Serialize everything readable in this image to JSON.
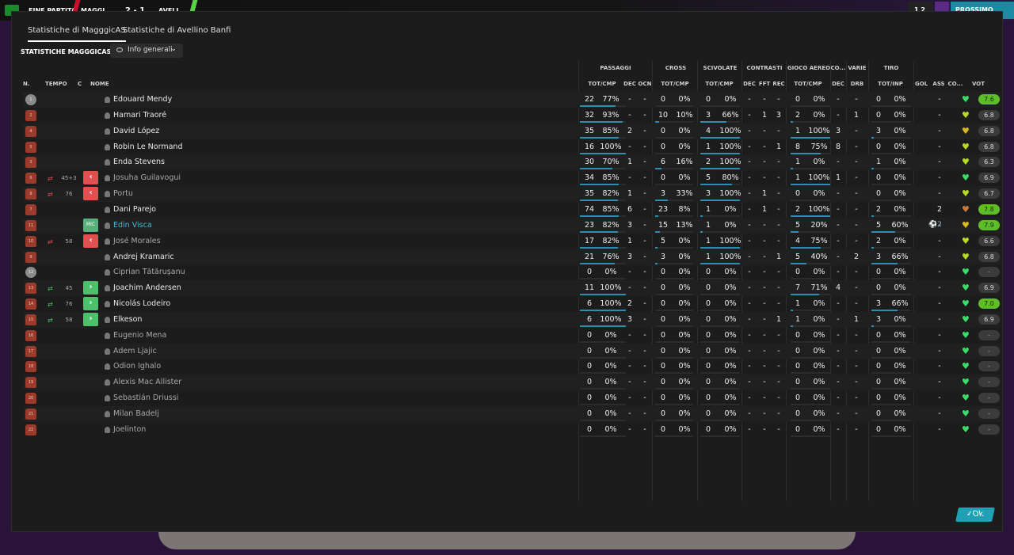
{
  "topbar": {
    "left_label": "FINE PARTITA",
    "home": "MAGGI...",
    "score": "2 - 1",
    "away": "AVELL...",
    "right_badge": "1 2",
    "right_button": "PROSSIMO"
  },
  "tabs": [
    {
      "label": "Statistiche di MagggicAS",
      "active": true
    },
    {
      "label": "Statistiche di Avellino Banfi",
      "active": false
    }
  ],
  "section_title": "STATISTICHE MAGGGICAS",
  "view_dropdown": {
    "selected": "Info generali",
    "icon": "eye-icon"
  },
  "column_groups": [
    "PASSAGGI",
    "CROSS",
    "SCIVOLATE",
    "CONTRASTI",
    "GIOCO AEREO",
    "CO...",
    "VARIE",
    "TIRO"
  ],
  "columns": {
    "num": "N.",
    "tempo": "TEMPO",
    "c": "C",
    "nome": "NOME",
    "pass_totcmp": "TOT/CMP",
    "pass_dec": "DEC",
    "pass_ocn": "OCN",
    "cross_totcmp": "TOT/CMP",
    "sciv_totcmp": "TOT/CMP",
    "contr_dec": "DEC",
    "contr_fft": "FFT",
    "contr_rec": "REC",
    "aereo_totcmp": "TOT/CMP",
    "co_dec": "DEC",
    "varie_drb": "DRB",
    "tiro_totinp": "TOT/INP",
    "gol": "GOL",
    "ass": "ASS",
    "co": "CO...",
    "voto": "VOT"
  },
  "players": [
    {
      "num": "1",
      "gk": true,
      "sub_icon": "",
      "time": "",
      "badge": "",
      "name": "Edouard Mendy",
      "style": "normal",
      "pass_tot": "22",
      "pass_pct": "77%",
      "pass_dec": "-",
      "pass_ocn": "-",
      "cross_tot": "0",
      "cross_pct": "0%",
      "sciv_tot": "0",
      "sciv_pct": "0%",
      "c_dec": "-",
      "c_fft": "-",
      "c_rec": "-",
      "aer_tot": "0",
      "aer_pct": "0%",
      "co_dec": "-",
      "drb": "-",
      "tiro_tot": "0",
      "tiro_pct": "0%",
      "gol": "",
      "ass": "-",
      "heart": "#3ddc6a",
      "voto": "7.6",
      "good": true
    },
    {
      "num": "2",
      "gk": false,
      "sub_icon": "",
      "time": "",
      "badge": "",
      "name": "Hamari Traoré",
      "style": "normal",
      "pass_tot": "32",
      "pass_pct": "93%",
      "pass_dec": "-",
      "pass_ocn": "-",
      "cross_tot": "10",
      "cross_pct": "10%",
      "sciv_tot": "3",
      "sciv_pct": "66%",
      "c_dec": "-",
      "c_fft": "1",
      "c_rec": "3",
      "aer_tot": "2",
      "aer_pct": "0%",
      "co_dec": "-",
      "drb": "1",
      "tiro_tot": "0",
      "tiro_pct": "0%",
      "gol": "",
      "ass": "-",
      "heart": "#b8d82a",
      "voto": "6.8",
      "good": false
    },
    {
      "num": "4",
      "gk": false,
      "sub_icon": "",
      "time": "",
      "badge": "",
      "name": "David López",
      "style": "normal",
      "pass_tot": "35",
      "pass_pct": "85%",
      "pass_dec": "2",
      "pass_ocn": "-",
      "cross_tot": "0",
      "cross_pct": "0%",
      "sciv_tot": "4",
      "sciv_pct": "100%",
      "c_dec": "-",
      "c_fft": "-",
      "c_rec": "-",
      "aer_tot": "1",
      "aer_pct": "100%",
      "co_dec": "3",
      "drb": "-",
      "tiro_tot": "3",
      "tiro_pct": "0%",
      "gol": "",
      "ass": "-",
      "heart": "#d8b82a",
      "voto": "6.8",
      "good": false
    },
    {
      "num": "5",
      "gk": false,
      "sub_icon": "",
      "time": "",
      "badge": "",
      "name": "Robin Le Normand",
      "style": "normal",
      "pass_tot": "16",
      "pass_pct": "100%",
      "pass_dec": "-",
      "pass_ocn": "-",
      "cross_tot": "0",
      "cross_pct": "0%",
      "sciv_tot": "1",
      "sciv_pct": "100%",
      "c_dec": "-",
      "c_fft": "-",
      "c_rec": "1",
      "aer_tot": "8",
      "aer_pct": "75%",
      "co_dec": "8",
      "drb": "-",
      "tiro_tot": "0",
      "tiro_pct": "0%",
      "gol": "",
      "ass": "-",
      "heart": "#b8d82a",
      "voto": "6.8",
      "good": false
    },
    {
      "num": "3",
      "gk": false,
      "sub_icon": "",
      "time": "",
      "badge": "",
      "name": "Enda Stevens",
      "style": "normal",
      "pass_tot": "30",
      "pass_pct": "70%",
      "pass_dec": "1",
      "pass_ocn": "-",
      "cross_tot": "6",
      "cross_pct": "16%",
      "sciv_tot": "2",
      "sciv_pct": "100%",
      "c_dec": "-",
      "c_fft": "-",
      "c_rec": "-",
      "aer_tot": "1",
      "aer_pct": "0%",
      "co_dec": "-",
      "drb": "-",
      "tiro_tot": "1",
      "tiro_pct": "0%",
      "gol": "",
      "ass": "-",
      "heart": "#b8d82a",
      "voto": "6.3",
      "good": false
    },
    {
      "num": "6",
      "gk": false,
      "sub_icon": "out",
      "time": "45+3",
      "badge": "out",
      "name": "Josuha Guilavogui",
      "style": "dim",
      "pass_tot": "34",
      "pass_pct": "85%",
      "pass_dec": "-",
      "pass_ocn": "-",
      "cross_tot": "0",
      "cross_pct": "0%",
      "sciv_tot": "5",
      "sciv_pct": "80%",
      "c_dec": "-",
      "c_fft": "-",
      "c_rec": "-",
      "aer_tot": "1",
      "aer_pct": "100%",
      "co_dec": "1",
      "drb": "-",
      "tiro_tot": "0",
      "tiro_pct": "0%",
      "gol": "",
      "ass": "-",
      "heart": "#3ddc6a",
      "voto": "6.9",
      "good": false
    },
    {
      "num": "8",
      "gk": false,
      "sub_icon": "out",
      "time": "76",
      "badge": "out",
      "name": "Portu",
      "style": "dim",
      "pass_tot": "35",
      "pass_pct": "82%",
      "pass_dec": "1",
      "pass_ocn": "-",
      "cross_tot": "3",
      "cross_pct": "33%",
      "sciv_tot": "3",
      "sciv_pct": "100%",
      "c_dec": "-",
      "c_fft": "1",
      "c_rec": "-",
      "aer_tot": "0",
      "aer_pct": "0%",
      "co_dec": "-",
      "drb": "-",
      "tiro_tot": "0",
      "tiro_pct": "0%",
      "gol": "",
      "ass": "-",
      "heart": "#b8d82a",
      "voto": "6.7",
      "good": false
    },
    {
      "num": "7",
      "gk": false,
      "sub_icon": "",
      "time": "",
      "badge": "",
      "name": "Dani Parejo",
      "style": "normal",
      "pass_tot": "74",
      "pass_pct": "85%",
      "pass_dec": "6",
      "pass_ocn": "-",
      "cross_tot": "23",
      "cross_pct": "8%",
      "sciv_tot": "1",
      "sciv_pct": "0%",
      "c_dec": "-",
      "c_fft": "1",
      "c_rec": "-",
      "aer_tot": "2",
      "aer_pct": "100%",
      "co_dec": "-",
      "drb": "-",
      "tiro_tot": "2",
      "tiro_pct": "0%",
      "gol": "",
      "ass": "2",
      "heart": "#c87a3a",
      "voto": "7.8",
      "good": true
    },
    {
      "num": "11",
      "gk": false,
      "sub_icon": "",
      "time": "",
      "badge": "pos",
      "name": "Edin Visca",
      "style": "link",
      "pass_tot": "23",
      "pass_pct": "82%",
      "pass_dec": "3",
      "pass_ocn": "-",
      "cross_tot": "15",
      "cross_pct": "13%",
      "sciv_tot": "1",
      "sciv_pct": "0%",
      "c_dec": "-",
      "c_fft": "-",
      "c_rec": "-",
      "aer_tot": "5",
      "aer_pct": "20%",
      "co_dec": "-",
      "drb": "-",
      "tiro_tot": "5",
      "tiro_pct": "60%",
      "gol": "2",
      "ass": "-",
      "heart": "#d8b82a",
      "voto": "7.9",
      "good": true
    },
    {
      "num": "10",
      "gk": false,
      "sub_icon": "out",
      "time": "58",
      "badge": "out",
      "name": "José Morales",
      "style": "dim",
      "pass_tot": "17",
      "pass_pct": "82%",
      "pass_dec": "1",
      "pass_ocn": "-",
      "cross_tot": "5",
      "cross_pct": "0%",
      "sciv_tot": "1",
      "sciv_pct": "100%",
      "c_dec": "-",
      "c_fft": "-",
      "c_rec": "-",
      "aer_tot": "4",
      "aer_pct": "75%",
      "co_dec": "-",
      "drb": "-",
      "tiro_tot": "2",
      "tiro_pct": "0%",
      "gol": "",
      "ass": "-",
      "heart": "#b8d82a",
      "voto": "6.6",
      "good": false
    },
    {
      "num": "9",
      "gk": false,
      "sub_icon": "",
      "time": "",
      "badge": "",
      "name": "Andrej Kramaric",
      "style": "normal",
      "pass_tot": "21",
      "pass_pct": "76%",
      "pass_dec": "3",
      "pass_ocn": "-",
      "cross_tot": "3",
      "cross_pct": "0%",
      "sciv_tot": "1",
      "sciv_pct": "100%",
      "c_dec": "-",
      "c_fft": "-",
      "c_rec": "1",
      "aer_tot": "5",
      "aer_pct": "40%",
      "co_dec": "-",
      "drb": "2",
      "tiro_tot": "3",
      "tiro_pct": "66%",
      "gol": "",
      "ass": "-",
      "heart": "#b8d82a",
      "voto": "6.8",
      "good": false
    },
    {
      "num": "12",
      "gk": true,
      "sub_icon": "",
      "time": "",
      "badge": "",
      "name": "Ciprian Tătărușanu",
      "style": "dim",
      "pass_tot": "0",
      "pass_pct": "0%",
      "pass_dec": "-",
      "pass_ocn": "-",
      "cross_tot": "0",
      "cross_pct": "0%",
      "sciv_tot": "0",
      "sciv_pct": "0%",
      "c_dec": "-",
      "c_fft": "-",
      "c_rec": "-",
      "aer_tot": "0",
      "aer_pct": "0%",
      "co_dec": "-",
      "drb": "-",
      "tiro_tot": "0",
      "tiro_pct": "0%",
      "gol": "",
      "ass": "-",
      "heart": "#3ddc6a",
      "voto": "-",
      "good": false
    },
    {
      "num": "13",
      "gk": false,
      "sub_icon": "in",
      "time": "45",
      "badge": "in",
      "name": "Joachim Andersen",
      "style": "normal",
      "pass_tot": "11",
      "pass_pct": "100%",
      "pass_dec": "-",
      "pass_ocn": "-",
      "cross_tot": "0",
      "cross_pct": "0%",
      "sciv_tot": "0",
      "sciv_pct": "0%",
      "c_dec": "-",
      "c_fft": "-",
      "c_rec": "-",
      "aer_tot": "7",
      "aer_pct": "71%",
      "co_dec": "4",
      "drb": "-",
      "tiro_tot": "0",
      "tiro_pct": "0%",
      "gol": "",
      "ass": "-",
      "heart": "#3ddc6a",
      "voto": "6.9",
      "good": false
    },
    {
      "num": "14",
      "gk": false,
      "sub_icon": "in",
      "time": "76",
      "badge": "in",
      "name": "Nicolás Lodeiro",
      "style": "normal",
      "pass_tot": "6",
      "pass_pct": "100%",
      "pass_dec": "2",
      "pass_ocn": "-",
      "cross_tot": "0",
      "cross_pct": "0%",
      "sciv_tot": "0",
      "sciv_pct": "0%",
      "c_dec": "-",
      "c_fft": "-",
      "c_rec": "-",
      "aer_tot": "1",
      "aer_pct": "0%",
      "co_dec": "-",
      "drb": "-",
      "tiro_tot": "3",
      "tiro_pct": "66%",
      "gol": "",
      "ass": "-",
      "heart": "#3ddc6a",
      "voto": "7.0",
      "good": true
    },
    {
      "num": "15",
      "gk": false,
      "sub_icon": "in",
      "time": "58",
      "badge": "in",
      "name": "Elkeson",
      "style": "normal",
      "pass_tot": "6",
      "pass_pct": "100%",
      "pass_dec": "3",
      "pass_ocn": "-",
      "cross_tot": "0",
      "cross_pct": "0%",
      "sciv_tot": "0",
      "sciv_pct": "0%",
      "c_dec": "-",
      "c_fft": "-",
      "c_rec": "1",
      "aer_tot": "1",
      "aer_pct": "0%",
      "co_dec": "-",
      "drb": "1",
      "tiro_tot": "3",
      "tiro_pct": "0%",
      "gol": "",
      "ass": "-",
      "heart": "#3ddc6a",
      "voto": "6.9",
      "good": false
    },
    {
      "num": "16",
      "gk": false,
      "sub_icon": "",
      "time": "",
      "badge": "",
      "name": "Eugenio Mena",
      "style": "dim",
      "pass_tot": "0",
      "pass_pct": "0%",
      "pass_dec": "-",
      "pass_ocn": "-",
      "cross_tot": "0",
      "cross_pct": "0%",
      "sciv_tot": "0",
      "sciv_pct": "0%",
      "c_dec": "-",
      "c_fft": "-",
      "c_rec": "-",
      "aer_tot": "0",
      "aer_pct": "0%",
      "co_dec": "-",
      "drb": "-",
      "tiro_tot": "0",
      "tiro_pct": "0%",
      "gol": "",
      "ass": "-",
      "heart": "#3ddc6a",
      "voto": "-",
      "good": false
    },
    {
      "num": "17",
      "gk": false,
      "sub_icon": "",
      "time": "",
      "badge": "",
      "name": "Adem Ljajic",
      "style": "dim",
      "pass_tot": "0",
      "pass_pct": "0%",
      "pass_dec": "-",
      "pass_ocn": "-",
      "cross_tot": "0",
      "cross_pct": "0%",
      "sciv_tot": "0",
      "sciv_pct": "0%",
      "c_dec": "-",
      "c_fft": "-",
      "c_rec": "-",
      "aer_tot": "0",
      "aer_pct": "0%",
      "co_dec": "-",
      "drb": "-",
      "tiro_tot": "0",
      "tiro_pct": "0%",
      "gol": "",
      "ass": "-",
      "heart": "#3ddc6a",
      "voto": "-",
      "good": false
    },
    {
      "num": "18",
      "gk": false,
      "sub_icon": "",
      "time": "",
      "badge": "",
      "name": "Odion Ighalo",
      "style": "dim",
      "pass_tot": "0",
      "pass_pct": "0%",
      "pass_dec": "-",
      "pass_ocn": "-",
      "cross_tot": "0",
      "cross_pct": "0%",
      "sciv_tot": "0",
      "sciv_pct": "0%",
      "c_dec": "-",
      "c_fft": "-",
      "c_rec": "-",
      "aer_tot": "0",
      "aer_pct": "0%",
      "co_dec": "-",
      "drb": "-",
      "tiro_tot": "0",
      "tiro_pct": "0%",
      "gol": "",
      "ass": "-",
      "heart": "#3ddc6a",
      "voto": "-",
      "good": false
    },
    {
      "num": "19",
      "gk": false,
      "sub_icon": "",
      "time": "",
      "badge": "",
      "name": "Alexis Mac Allister",
      "style": "dim",
      "pass_tot": "0",
      "pass_pct": "0%",
      "pass_dec": "-",
      "pass_ocn": "-",
      "cross_tot": "0",
      "cross_pct": "0%",
      "sciv_tot": "0",
      "sciv_pct": "0%",
      "c_dec": "-",
      "c_fft": "-",
      "c_rec": "-",
      "aer_tot": "0",
      "aer_pct": "0%",
      "co_dec": "-",
      "drb": "-",
      "tiro_tot": "0",
      "tiro_pct": "0%",
      "gol": "",
      "ass": "-",
      "heart": "#3ddc6a",
      "voto": "-",
      "good": false
    },
    {
      "num": "20",
      "gk": false,
      "sub_icon": "",
      "time": "",
      "badge": "",
      "name": "Sebastián Driussi",
      "style": "dim",
      "pass_tot": "0",
      "pass_pct": "0%",
      "pass_dec": "-",
      "pass_ocn": "-",
      "cross_tot": "0",
      "cross_pct": "0%",
      "sciv_tot": "0",
      "sciv_pct": "0%",
      "c_dec": "-",
      "c_fft": "-",
      "c_rec": "-",
      "aer_tot": "0",
      "aer_pct": "0%",
      "co_dec": "-",
      "drb": "-",
      "tiro_tot": "0",
      "tiro_pct": "0%",
      "gol": "",
      "ass": "-",
      "heart": "#3ddc6a",
      "voto": "-",
      "good": false
    },
    {
      "num": "21",
      "gk": false,
      "sub_icon": "",
      "time": "",
      "badge": "",
      "name": "Milan Badelj",
      "style": "dim",
      "pass_tot": "0",
      "pass_pct": "0%",
      "pass_dec": "-",
      "pass_ocn": "-",
      "cross_tot": "0",
      "cross_pct": "0%",
      "sciv_tot": "0",
      "sciv_pct": "0%",
      "c_dec": "-",
      "c_fft": "-",
      "c_rec": "-",
      "aer_tot": "0",
      "aer_pct": "0%",
      "co_dec": "-",
      "drb": "-",
      "tiro_tot": "0",
      "tiro_pct": "0%",
      "gol": "",
      "ass": "-",
      "heart": "#3ddc6a",
      "voto": "-",
      "good": false
    },
    {
      "num": "22",
      "gk": false,
      "sub_icon": "",
      "time": "",
      "badge": "",
      "name": "Joelinton",
      "style": "dim",
      "pass_tot": "0",
      "pass_pct": "0%",
      "pass_dec": "-",
      "pass_ocn": "-",
      "cross_tot": "0",
      "cross_pct": "0%",
      "sciv_tot": "0",
      "sciv_pct": "0%",
      "c_dec": "-",
      "c_fft": "-",
      "c_rec": "-",
      "aer_tot": "0",
      "aer_pct": "0%",
      "co_dec": "-",
      "drb": "-",
      "tiro_tot": "0",
      "tiro_pct": "0%",
      "gol": "",
      "ass": "-",
      "heart": "#3ddc6a",
      "voto": "-",
      "good": false
    }
  ],
  "pos_badge_label": "MiC",
  "ok_button": "Ok"
}
